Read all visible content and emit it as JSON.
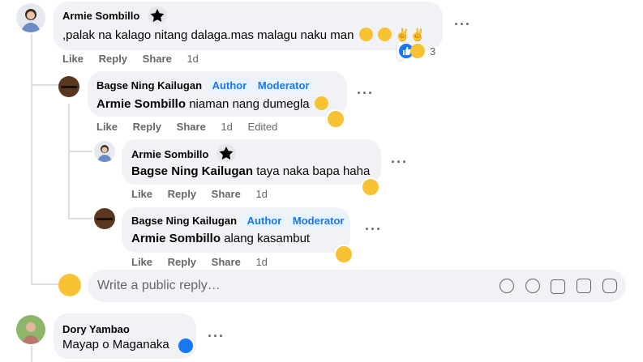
{
  "comments": {
    "c1": {
      "author": "Armie Sombillo",
      "text": ",palak na kalago nitang dalaga.mas malagu naku man",
      "actions": {
        "like": "Like",
        "reply": "Reply",
        "share": "Share",
        "time": "1d"
      },
      "reaction_count": "3"
    },
    "r1": {
      "author": "Bagse Ning Kailugan",
      "badge_author": "Author",
      "badge_moderator": "Moderator",
      "mention": "Armie Sombillo",
      "text": " niaman nang dumegla",
      "actions": {
        "like": "Like",
        "reply": "Reply",
        "share": "Share",
        "time": "1d",
        "edited": "Edited"
      }
    },
    "r2": {
      "author": "Armie Sombillo",
      "mention": "Bagse Ning Kailugan",
      "text": " taya naka bapa haha",
      "actions": {
        "like": "Like",
        "reply": "Reply",
        "share": "Share",
        "time": "1d"
      }
    },
    "r3": {
      "author": "Bagse Ning Kailugan",
      "badge_author": "Author",
      "badge_moderator": "Moderator",
      "mention": "Armie Sombillo",
      "text": " alang kasambut",
      "actions": {
        "like": "Like",
        "reply": "Reply",
        "share": "Share",
        "time": "1d"
      }
    },
    "c2": {
      "author": "Dory Yambao",
      "text": "Mayap o Maganaka"
    }
  },
  "reply_box": {
    "placeholder": "Write a public reply…",
    "icons": [
      "sticker-icon",
      "emoji-icon",
      "camera-icon",
      "gif-icon",
      "avatar-sticker-icon"
    ]
  },
  "icons": {
    "more": "more-icon",
    "top_fan": "star-badge-icon"
  },
  "colors": {
    "accent": "#1877f2",
    "bubble": "#f0f2f5",
    "muted": "#65676b"
  }
}
